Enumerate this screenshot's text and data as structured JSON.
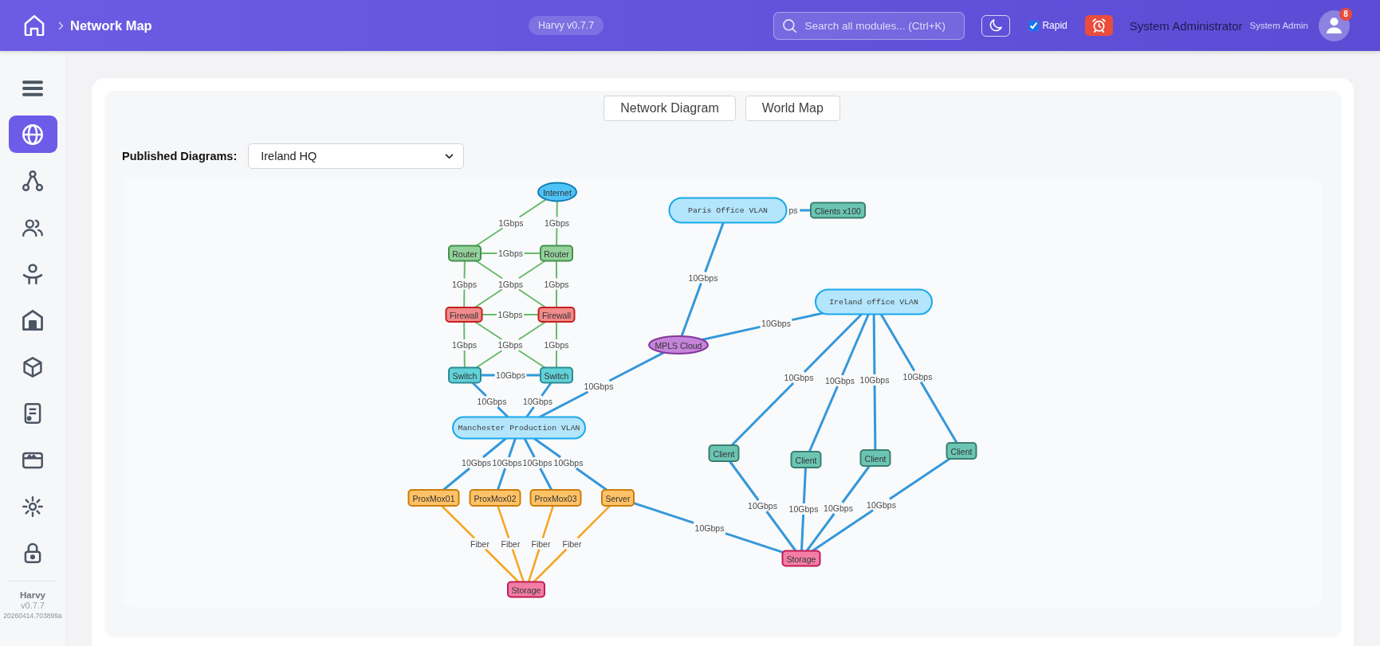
{
  "header": {
    "breadcrumb": "Network Map",
    "version_badge": "Harvy v0.7.7",
    "search": {
      "placeholder": "Search all modules... (Ctrl+K)"
    },
    "rapid": {
      "label": "Rapid",
      "checked": true
    },
    "user": {
      "name": "System Administrator",
      "role": "System Admin",
      "notifications": "8"
    }
  },
  "sidebar": {
    "items": [
      {
        "selected": true
      },
      {
        "selected": false
      },
      {
        "selected": false
      },
      {
        "selected": false
      },
      {
        "selected": false
      },
      {
        "selected": false
      },
      {
        "selected": false
      },
      {
        "selected": false
      },
      {
        "selected": false
      },
      {
        "selected": false
      }
    ],
    "footer": {
      "app": "Harvy",
      "version": "v0.7.7",
      "build": "20260414.703899a"
    }
  },
  "tabs": [
    {
      "label": "Network Diagram"
    },
    {
      "label": "World Map"
    }
  ],
  "diagram_picker": {
    "label": "Published Diagrams:",
    "value": "Ireland HQ"
  },
  "diagram": {
    "nodes": [
      {
        "label": "Internet",
        "kind": "ellipse",
        "color": "#4fc3f7"
      },
      {
        "label": "Router",
        "kind": "box",
        "color": "#93d19b"
      },
      {
        "label": "Router",
        "kind": "box",
        "color": "#93d19b"
      },
      {
        "label": "Firewall",
        "kind": "box",
        "color": "#f28b8b"
      },
      {
        "label": "Firewall",
        "kind": "box",
        "color": "#f28b8b"
      },
      {
        "label": "Switch",
        "kind": "box",
        "color": "#62d2d9"
      },
      {
        "label": "Switch",
        "kind": "box",
        "color": "#62d2d9"
      },
      {
        "label": "Manchester Production VLAN",
        "kind": "pill",
        "color": "#b3e5fc"
      },
      {
        "label": "MPLS Cloud",
        "kind": "ellipse",
        "color": "#c583d9"
      },
      {
        "label": "Paris Office VLAN",
        "kind": "pill",
        "color": "#b3e5fc"
      },
      {
        "label": "Clients x100",
        "kind": "box",
        "color": "#6cc5b3"
      },
      {
        "label": "Ireland office VLAN",
        "kind": "pill",
        "color": "#b3e5fc"
      },
      {
        "label": "Client",
        "kind": "box",
        "color": "#6cc5b3"
      },
      {
        "label": "Client",
        "kind": "box",
        "color": "#6cc5b3"
      },
      {
        "label": "Client",
        "kind": "box",
        "color": "#6cc5b3"
      },
      {
        "label": "Client",
        "kind": "box",
        "color": "#6cc5b3"
      },
      {
        "label": "Storage",
        "kind": "box",
        "color": "#f27ea6"
      },
      {
        "label": "ProxMox01",
        "kind": "box",
        "color": "#ffc266"
      },
      {
        "label": "ProxMox02",
        "kind": "box",
        "color": "#ffc266"
      },
      {
        "label": "ProxMox03",
        "kind": "box",
        "color": "#ffc266"
      },
      {
        "label": "Server",
        "kind": "box",
        "color": "#ffc266"
      },
      {
        "label": "Storage",
        "kind": "box",
        "color": "#f27ea6"
      }
    ],
    "links": [
      {
        "label": "1Gbps",
        "color": "#66bb6a"
      },
      {
        "label": "1Gbps",
        "color": "#66bb6a"
      },
      {
        "label": "1Gbps",
        "color": "#66bb6a"
      },
      {
        "label": "1Gbps",
        "color": "#66bb6a"
      },
      {
        "label": "1Gbps",
        "color": "#66bb6a"
      },
      {
        "color": "#66bb6a"
      },
      {
        "label": "1Gbps",
        "color": "#66bb6a"
      },
      {
        "label": "1Gbps",
        "color": "#66bb6a"
      },
      {
        "label": "1Gbps",
        "color": "#66bb6a"
      },
      {
        "label": "1Gbps",
        "color": "#66bb6a"
      },
      {
        "color": "#66bb6a"
      },
      {
        "label": "1Gbps",
        "color": "#66bb6a"
      },
      {
        "label": "10Gbps",
        "color": "#3498db"
      },
      {
        "label": "10Gbps",
        "color": "#3498db"
      },
      {
        "label": "10Gbps",
        "color": "#3498db"
      },
      {
        "label": "10Gbps",
        "color": "#3498db"
      },
      {
        "label": "10Gbps",
        "color": "#3498db"
      },
      {
        "label": "ps",
        "color": "#3498db"
      },
      {
        "label": "10Gbps",
        "color": "#3498db"
      },
      {
        "label": "10Gbps",
        "color": "#3498db"
      },
      {
        "label": "10Gbps",
        "color": "#3498db"
      },
      {
        "label": "10Gbps",
        "color": "#3498db"
      },
      {
        "label": "10Gbps",
        "color": "#3498db"
      },
      {
        "label": "10Gbps",
        "color": "#3498db"
      },
      {
        "label": "10Gbps",
        "color": "#3498db"
      },
      {
        "label": "10Gbps",
        "color": "#3498db"
      },
      {
        "label": "10Gbps",
        "color": "#3498db"
      },
      {
        "label": "10Gbps",
        "color": "#3498db"
      },
      {
        "label": "10Gbps",
        "color": "#3498db"
      },
      {
        "label": "10Gbps",
        "color": "#3498db"
      },
      {
        "label": "10Gbps",
        "color": "#3498db"
      },
      {
        "label": "Fiber",
        "color": "#f5a623"
      },
      {
        "label": "Fiber",
        "color": "#f5a623"
      },
      {
        "label": "Fiber",
        "color": "#f5a623"
      },
      {
        "label": "Fiber",
        "color": "#f5a623"
      },
      {
        "label": "10Gbps",
        "color": "#3498db"
      }
    ]
  }
}
